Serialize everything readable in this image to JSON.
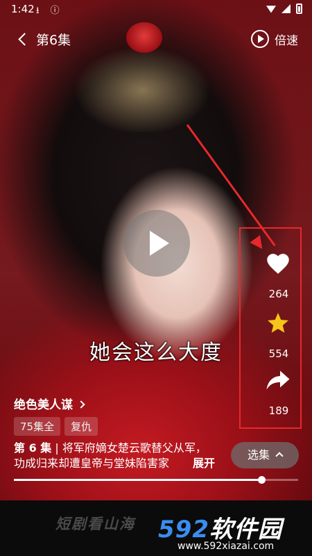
{
  "status_bar": {
    "time": "1:42",
    "icons": [
      "download-icon",
      "alert-icon"
    ]
  },
  "top_bar": {
    "episode_title": "第6集",
    "speed_label": "倍速"
  },
  "video": {
    "subtitle": "她会这么大度"
  },
  "actions": [
    {
      "name": "like",
      "icon": "heart-icon",
      "count": "264"
    },
    {
      "name": "favorite",
      "icon": "star-icon",
      "count": "554",
      "color": "#f5c518"
    },
    {
      "name": "share",
      "icon": "share-icon",
      "count": "189"
    }
  ],
  "annotation": {
    "color": "#e8282b"
  },
  "info": {
    "drama_title": "绝色美人谋",
    "tags": [
      "75集全",
      "复仇"
    ],
    "episode_label": "第 6 集",
    "description": "| 将军府嫡女楚云歌替父从军，",
    "description_line2": "功成归来却遭皇帝与堂妹陷害家",
    "expand_label": "展开",
    "select_label": "选集"
  },
  "progress": {
    "fraction": 0.87
  },
  "bottom": {
    "slogan": "短剧看山海",
    "watermark_number": "592",
    "watermark_text": "软件园",
    "watermark_url": "www.592xiazai.com"
  }
}
